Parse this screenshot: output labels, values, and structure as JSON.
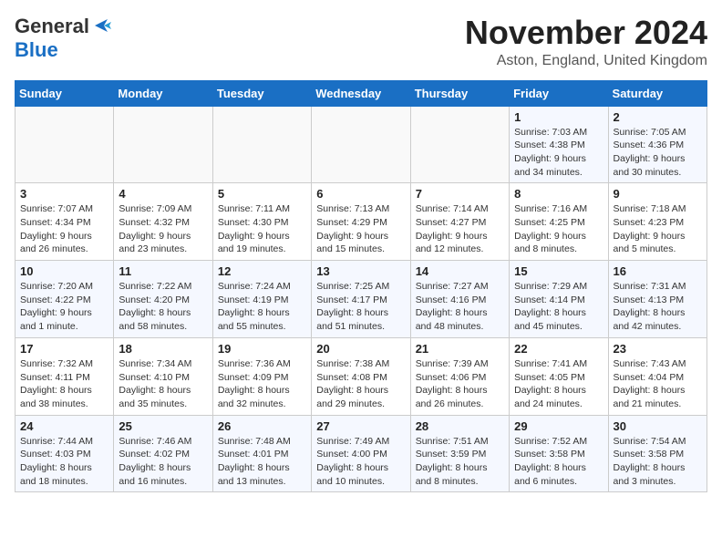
{
  "logo": {
    "line1": "General",
    "line2": "Blue",
    "icon": "▶"
  },
  "title": "November 2024",
  "location": "Aston, England, United Kingdom",
  "days_of_week": [
    "Sunday",
    "Monday",
    "Tuesday",
    "Wednesday",
    "Thursday",
    "Friday",
    "Saturday"
  ],
  "weeks": [
    [
      {
        "day": "",
        "info": ""
      },
      {
        "day": "",
        "info": ""
      },
      {
        "day": "",
        "info": ""
      },
      {
        "day": "",
        "info": ""
      },
      {
        "day": "",
        "info": ""
      },
      {
        "day": "1",
        "info": "Sunrise: 7:03 AM\nSunset: 4:38 PM\nDaylight: 9 hours\nand 34 minutes."
      },
      {
        "day": "2",
        "info": "Sunrise: 7:05 AM\nSunset: 4:36 PM\nDaylight: 9 hours\nand 30 minutes."
      }
    ],
    [
      {
        "day": "3",
        "info": "Sunrise: 7:07 AM\nSunset: 4:34 PM\nDaylight: 9 hours\nand 26 minutes."
      },
      {
        "day": "4",
        "info": "Sunrise: 7:09 AM\nSunset: 4:32 PM\nDaylight: 9 hours\nand 23 minutes."
      },
      {
        "day": "5",
        "info": "Sunrise: 7:11 AM\nSunset: 4:30 PM\nDaylight: 9 hours\nand 19 minutes."
      },
      {
        "day": "6",
        "info": "Sunrise: 7:13 AM\nSunset: 4:29 PM\nDaylight: 9 hours\nand 15 minutes."
      },
      {
        "day": "7",
        "info": "Sunrise: 7:14 AM\nSunset: 4:27 PM\nDaylight: 9 hours\nand 12 minutes."
      },
      {
        "day": "8",
        "info": "Sunrise: 7:16 AM\nSunset: 4:25 PM\nDaylight: 9 hours\nand 8 minutes."
      },
      {
        "day": "9",
        "info": "Sunrise: 7:18 AM\nSunset: 4:23 PM\nDaylight: 9 hours\nand 5 minutes."
      }
    ],
    [
      {
        "day": "10",
        "info": "Sunrise: 7:20 AM\nSunset: 4:22 PM\nDaylight: 9 hours\nand 1 minute."
      },
      {
        "day": "11",
        "info": "Sunrise: 7:22 AM\nSunset: 4:20 PM\nDaylight: 8 hours\nand 58 minutes."
      },
      {
        "day": "12",
        "info": "Sunrise: 7:24 AM\nSunset: 4:19 PM\nDaylight: 8 hours\nand 55 minutes."
      },
      {
        "day": "13",
        "info": "Sunrise: 7:25 AM\nSunset: 4:17 PM\nDaylight: 8 hours\nand 51 minutes."
      },
      {
        "day": "14",
        "info": "Sunrise: 7:27 AM\nSunset: 4:16 PM\nDaylight: 8 hours\nand 48 minutes."
      },
      {
        "day": "15",
        "info": "Sunrise: 7:29 AM\nSunset: 4:14 PM\nDaylight: 8 hours\nand 45 minutes."
      },
      {
        "day": "16",
        "info": "Sunrise: 7:31 AM\nSunset: 4:13 PM\nDaylight: 8 hours\nand 42 minutes."
      }
    ],
    [
      {
        "day": "17",
        "info": "Sunrise: 7:32 AM\nSunset: 4:11 PM\nDaylight: 8 hours\nand 38 minutes."
      },
      {
        "day": "18",
        "info": "Sunrise: 7:34 AM\nSunset: 4:10 PM\nDaylight: 8 hours\nand 35 minutes."
      },
      {
        "day": "19",
        "info": "Sunrise: 7:36 AM\nSunset: 4:09 PM\nDaylight: 8 hours\nand 32 minutes."
      },
      {
        "day": "20",
        "info": "Sunrise: 7:38 AM\nSunset: 4:08 PM\nDaylight: 8 hours\nand 29 minutes."
      },
      {
        "day": "21",
        "info": "Sunrise: 7:39 AM\nSunset: 4:06 PM\nDaylight: 8 hours\nand 26 minutes."
      },
      {
        "day": "22",
        "info": "Sunrise: 7:41 AM\nSunset: 4:05 PM\nDaylight: 8 hours\nand 24 minutes."
      },
      {
        "day": "23",
        "info": "Sunrise: 7:43 AM\nSunset: 4:04 PM\nDaylight: 8 hours\nand 21 minutes."
      }
    ],
    [
      {
        "day": "24",
        "info": "Sunrise: 7:44 AM\nSunset: 4:03 PM\nDaylight: 8 hours\nand 18 minutes."
      },
      {
        "day": "25",
        "info": "Sunrise: 7:46 AM\nSunset: 4:02 PM\nDaylight: 8 hours\nand 16 minutes."
      },
      {
        "day": "26",
        "info": "Sunrise: 7:48 AM\nSunset: 4:01 PM\nDaylight: 8 hours\nand 13 minutes."
      },
      {
        "day": "27",
        "info": "Sunrise: 7:49 AM\nSunset: 4:00 PM\nDaylight: 8 hours\nand 10 minutes."
      },
      {
        "day": "28",
        "info": "Sunrise: 7:51 AM\nSunset: 3:59 PM\nDaylight: 8 hours\nand 8 minutes."
      },
      {
        "day": "29",
        "info": "Sunrise: 7:52 AM\nSunset: 3:58 PM\nDaylight: 8 hours\nand 6 minutes."
      },
      {
        "day": "30",
        "info": "Sunrise: 7:54 AM\nSunset: 3:58 PM\nDaylight: 8 hours\nand 3 minutes."
      }
    ]
  ]
}
